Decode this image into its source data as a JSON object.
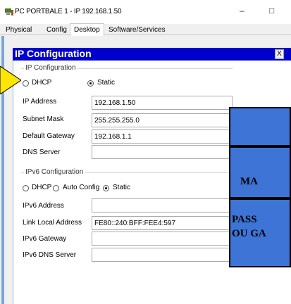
{
  "window": {
    "title": "PC PORTBALE 1 - IP 192.168.1.50",
    "minimize": "–",
    "maximize": "□"
  },
  "tabs": [
    "Physical",
    "Config",
    "Desktop",
    "Software/Services"
  ],
  "active_tab": "Desktop",
  "panel": {
    "title": "IP Configuration",
    "close": "X"
  },
  "ipv4_group": {
    "title": "IP Configuration",
    "dhcp_label": "DHCP",
    "static_label": "Static",
    "mode": "Static",
    "fields": [
      {
        "label": "IP Address",
        "value": "192.168.1.50"
      },
      {
        "label": "Subnet Mask",
        "value": "255.255.255.0"
      },
      {
        "label": "Default Gateway",
        "value": "192.168.1.1"
      },
      {
        "label": "DNS Server",
        "value": ""
      }
    ]
  },
  "ipv6_group": {
    "title": "IPv6 Configuration",
    "dhcp_label": "DHCP",
    "auto_label": "Auto Config",
    "static_label": "Static",
    "mode": "Static",
    "fields": [
      {
        "label": "IPv6 Address",
        "value": ""
      },
      {
        "label": "Link Local Address",
        "value": "FE80::240:BFF:FEE4:597"
      },
      {
        "label": "IPv6 Gateway",
        "value": ""
      },
      {
        "label": "IPv6 DNS Server",
        "value": ""
      }
    ]
  },
  "overlay": {
    "box2_text": "MA",
    "box3_line1": "PASS",
    "box3_line2": "OU GA"
  },
  "colors": {
    "panel_header": "#0000cc",
    "overlay_blue": "#3d74d6",
    "arrow": "#ffe600"
  }
}
